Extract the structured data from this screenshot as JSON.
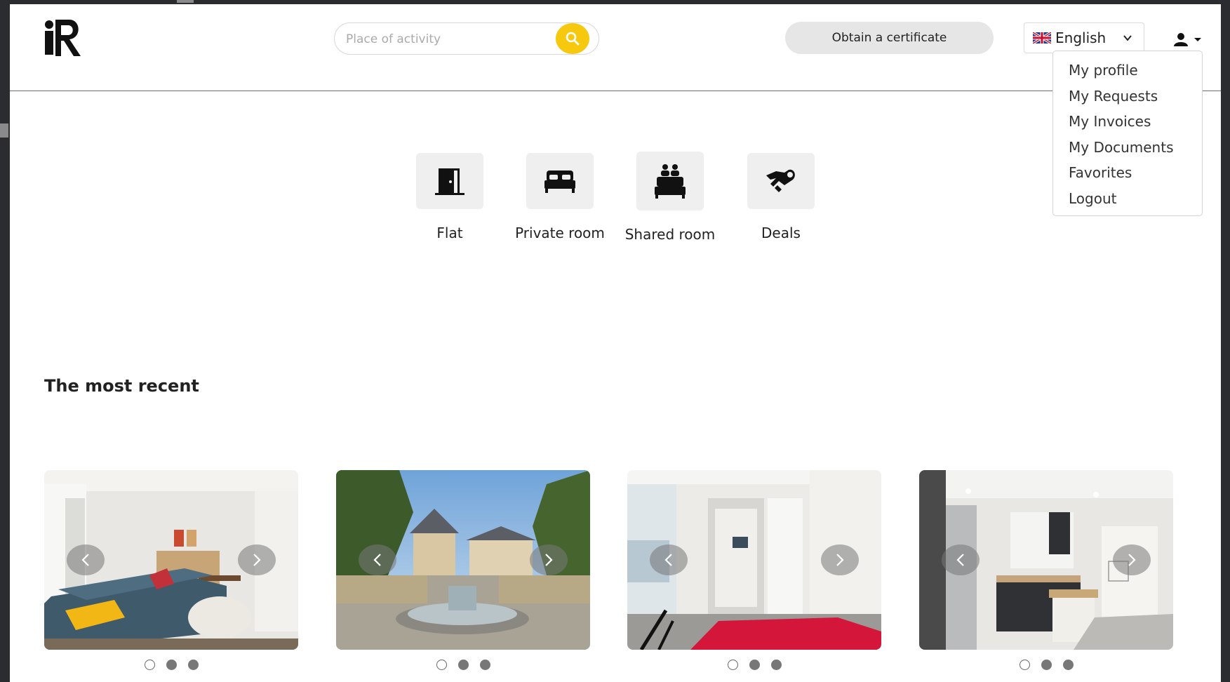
{
  "header": {
    "search": {
      "placeholder": "Place of activity",
      "value": ""
    },
    "certificate_button": "Obtain a certificate",
    "language": {
      "selected": "English",
      "flag": "uk-flag-icon"
    },
    "user_menu_icon": "user-icon"
  },
  "user_dropdown": {
    "items": [
      {
        "label": "My profile"
      },
      {
        "label": "My Requests"
      },
      {
        "label": "My Invoices"
      },
      {
        "label": "My Documents"
      },
      {
        "label": "Favorites"
      },
      {
        "label": "Logout"
      }
    ]
  },
  "categories": [
    {
      "label": "Flat",
      "icon": "door-icon"
    },
    {
      "label": "Private room",
      "icon": "bed-icon"
    },
    {
      "label": "Shared room",
      "icon": "shared-bed-icon"
    },
    {
      "label": "Deals",
      "icon": "handshake-icon"
    }
  ],
  "recent": {
    "title": "The most recent",
    "cards": [
      {
        "image": "living-room-photo",
        "dots": 3
      },
      {
        "image": "city-fountain-photo",
        "dots": 3
      },
      {
        "image": "bedroom-hallway-photo",
        "dots": 3
      },
      {
        "image": "kitchen-photo",
        "dots": 3
      }
    ]
  },
  "colors": {
    "accent": "#f6c90e",
    "button_gray": "#e6e6e6",
    "border": "#d9d9d9"
  }
}
